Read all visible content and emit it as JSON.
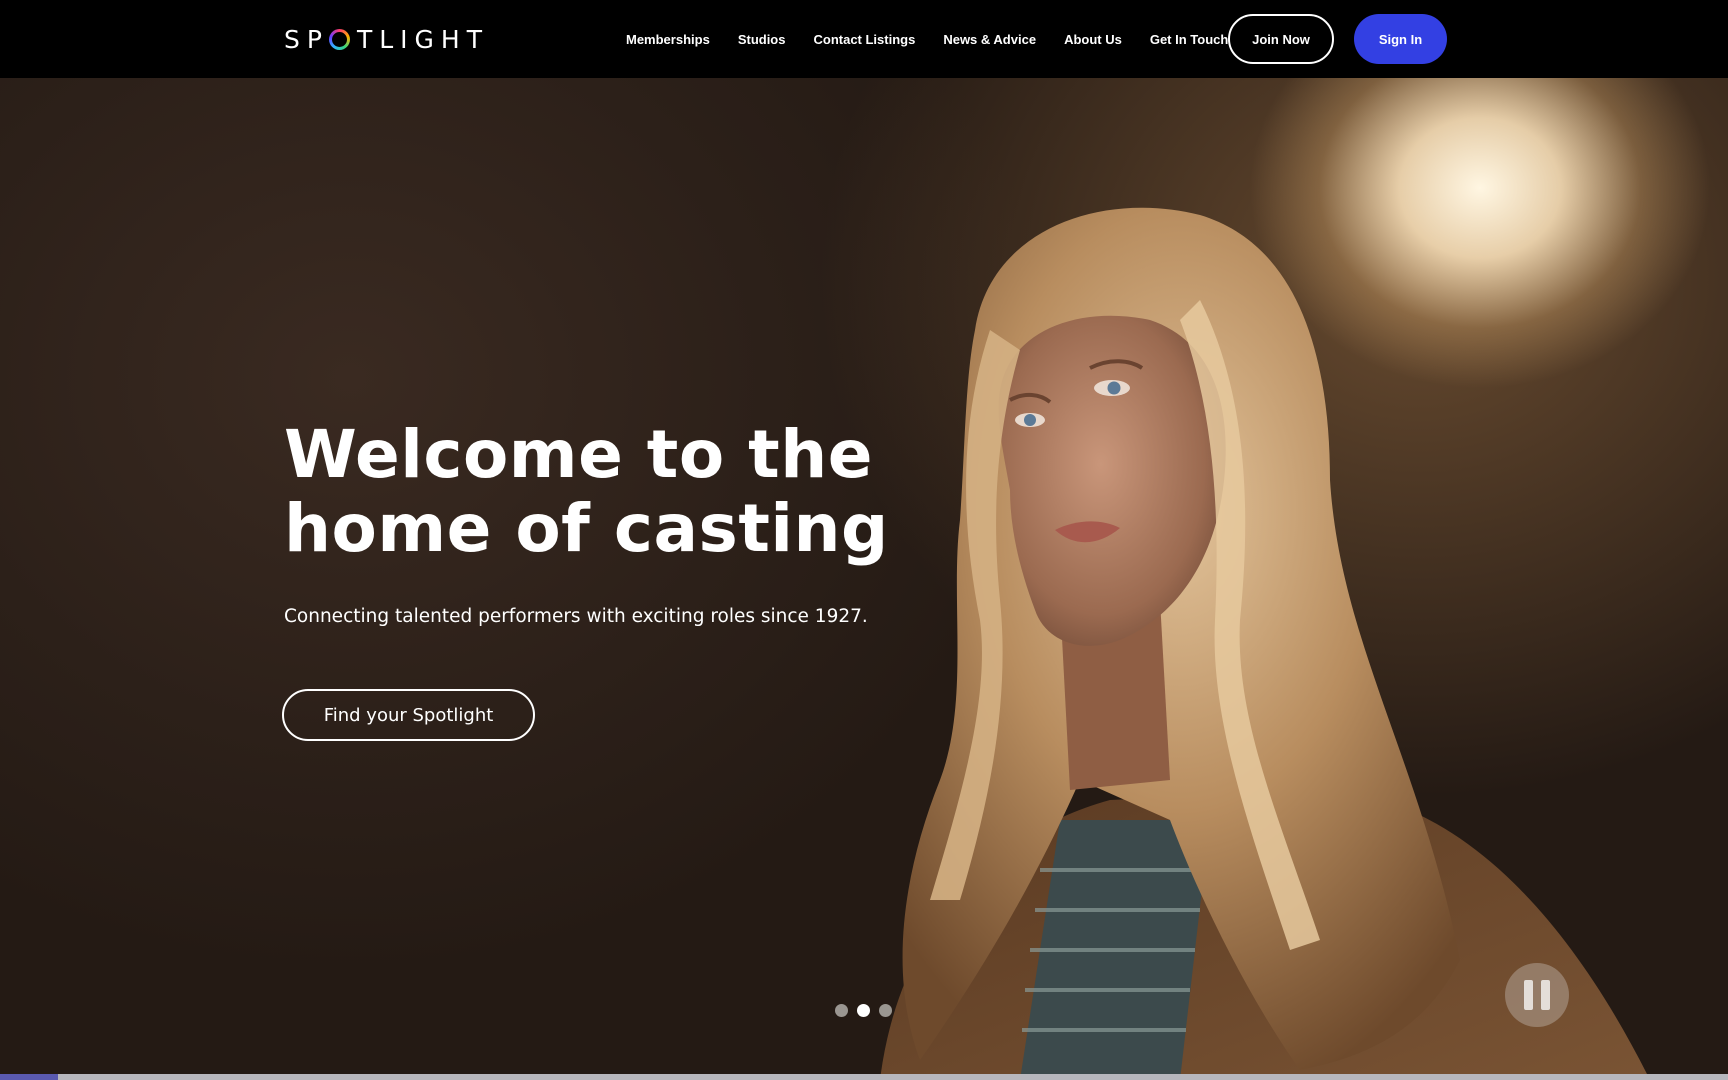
{
  "header": {
    "logo_text": "SP",
    "logo_text_rest": "TLIGHT",
    "nav": [
      "Memberships",
      "Studios",
      "Contact Listings",
      "News & Advice",
      "About Us",
      "Get In Touch"
    ],
    "join_label": "Join Now",
    "signin_label": "Sign In",
    "signin_color": "#3340e3"
  },
  "hero": {
    "title_line1": "Welcome to the",
    "title_line2": "home of casting",
    "subtitle": "Connecting talented performers with exciting roles since 1927.",
    "cta_label": "Find your Spotlight",
    "carousel_active": 2,
    "carousel_count": 3
  },
  "icons": {
    "pause": "pause-icon",
    "logo_ring": "spotlight-ring-icon"
  }
}
